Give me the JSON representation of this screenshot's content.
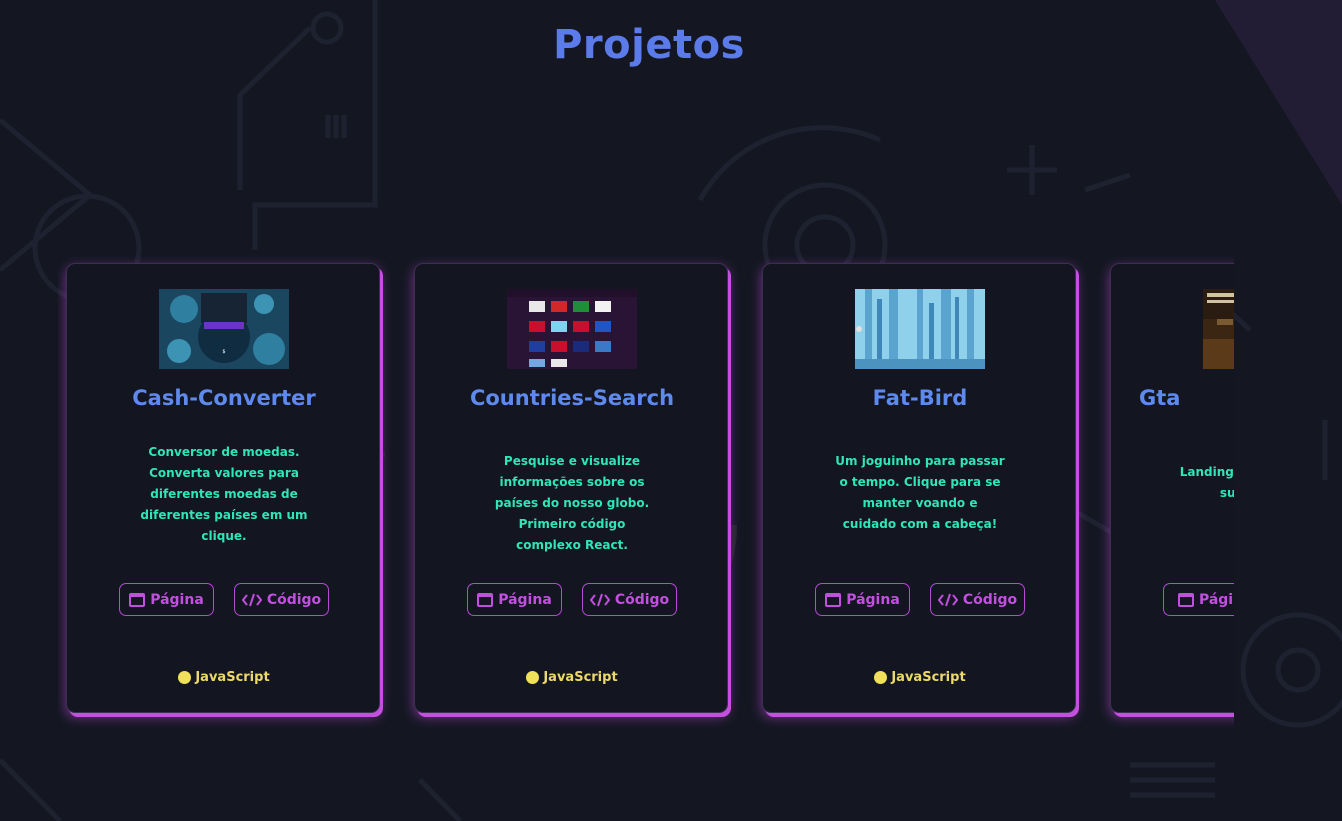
{
  "page": {
    "title": "Projetos"
  },
  "colors": {
    "background": "#141722",
    "title": "#5b7bea",
    "card_title": "#5e8af0",
    "description": "#2ee6b8",
    "button": "#c24fe0",
    "glow": "#c54fe0",
    "language_dot": "#f1e05a",
    "language_text": "#ecd96a"
  },
  "projects": [
    {
      "name": "Cash-Converter",
      "description": "Conversor de moedas. Converta valores para diferentes moedas de diferentes países em um clique.",
      "page_label": "Página",
      "code_label": "Código",
      "language": "JavaScript",
      "page_icon": "browser-window-icon",
      "code_icon": "code-brackets-icon"
    },
    {
      "name": "Countries-Search",
      "description": "Pesquise e visualize informações sobre os países do nosso globo. Primeiro código complexo React.",
      "page_label": "Página",
      "code_label": "Código",
      "language": "JavaScript",
      "page_icon": "browser-window-icon",
      "code_icon": "code-brackets-icon"
    },
    {
      "name": "Fat-Bird",
      "description": "Um joguinho para passar o tempo. Clique para se manter voando e cuidado com a cabeça!",
      "page_label": "Página",
      "code_label": "Código",
      "language": "JavaScript",
      "page_icon": "browser-window-icon",
      "code_icon": "code-brackets-icon"
    },
    {
      "name": "Gta",
      "description": "Landingpa o jogo, c suporte",
      "page_label": "Págin",
      "code_label": "",
      "language": "",
      "page_icon": "browser-window-icon",
      "code_icon": "code-brackets-icon"
    }
  ]
}
